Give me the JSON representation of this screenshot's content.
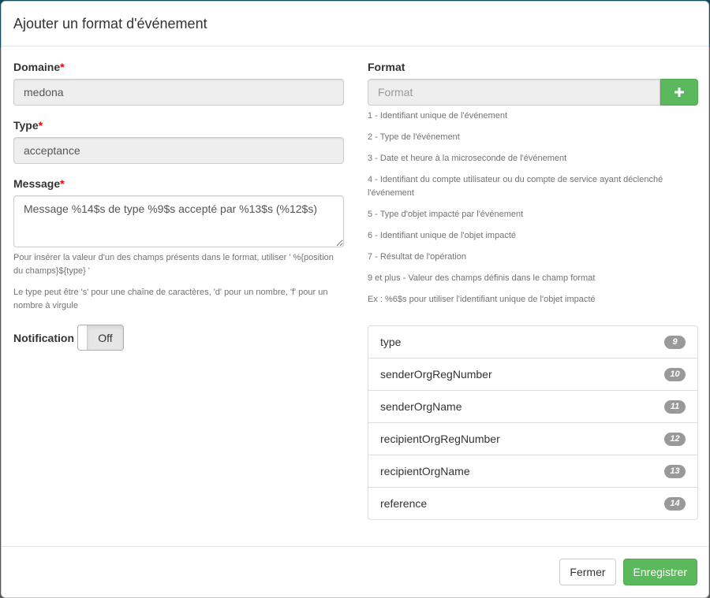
{
  "modal": {
    "title": "Ajouter un format d'événement"
  },
  "form": {
    "required_marker": "*",
    "domain": {
      "label": "Domaine",
      "value": "medona"
    },
    "type": {
      "label": "Type",
      "value": "acceptance"
    },
    "message": {
      "label": "Message",
      "value": "Message %14$s de type %9$s accepté par %13$s (%12$s)",
      "help": [
        "Pour insérer la valeur d'un des champs présents dans le format, utiliser ' %{position du champs}${type} '",
        "Le type peut être 's' pour une chaîne de caractères, 'd' pour un nombre, 'f' pour un nombre à virgule"
      ]
    },
    "notification": {
      "label": "Notification",
      "state": "Off"
    }
  },
  "format": {
    "label": "Format",
    "placeholder": "Format",
    "add_icon": "plus-icon",
    "legend": [
      "1 - Identifiant unique de l'événement",
      "2 - Type de l'événement",
      "3 - Date et heure à la microseconde de l'événement",
      "4 - Identifiant du compte utilisateur ou du compte de service ayant déclenché l'événement",
      "5 - Type d'objet impacté par l'événement",
      "6 - Identifiant unique de l'objet impacté",
      "7 - Résultat de l'opération",
      "9 et plus - Valeur des champs définis dans le champ format",
      "Ex : %6$s pour utiliser l'identifiant unique de l'objet impacté"
    ],
    "fields": [
      {
        "name": "type",
        "position": "9"
      },
      {
        "name": "senderOrgRegNumber",
        "position": "10"
      },
      {
        "name": "senderOrgName",
        "position": "11"
      },
      {
        "name": "recipientOrgRegNumber",
        "position": "12"
      },
      {
        "name": "recipientOrgName",
        "position": "13"
      },
      {
        "name": "reference",
        "position": "14"
      }
    ]
  },
  "footer": {
    "close_label": "Fermer",
    "save_label": "Enregistrer"
  },
  "colors": {
    "success": "#5cb85c",
    "required": "#ee0000",
    "badge": "#999999"
  }
}
